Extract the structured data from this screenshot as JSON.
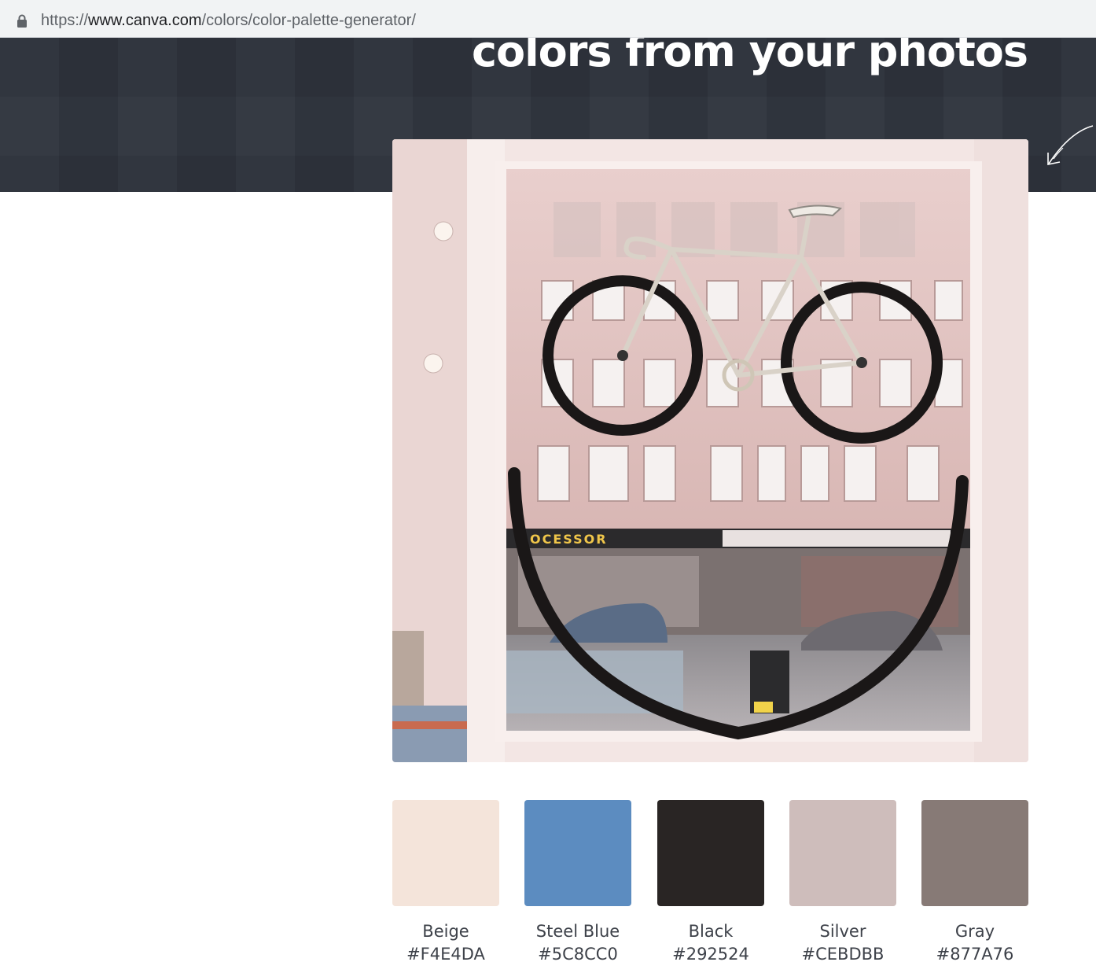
{
  "browser": {
    "url_prefix": "https://",
    "url_host": "www.canva.com",
    "url_path": "/colors/color-palette-generator/",
    "icons": {
      "secure": "lock-icon"
    }
  },
  "hero": {
    "title": "colors from your photos",
    "background": "#2e333c",
    "icons": {
      "decoration": "curved-arrow-icon"
    }
  },
  "photo": {
    "alt_icon": "uploaded-photo"
  },
  "palette": {
    "colors": [
      {
        "name": "Beige",
        "hex": "#F4E4DA"
      },
      {
        "name": "Steel Blue",
        "hex": "#5C8CC0"
      },
      {
        "name": "Black",
        "hex": "#292524"
      },
      {
        "name": "Silver",
        "hex": "#CEBDBB"
      },
      {
        "name": "Gray",
        "hex": "#877A76"
      }
    ]
  }
}
